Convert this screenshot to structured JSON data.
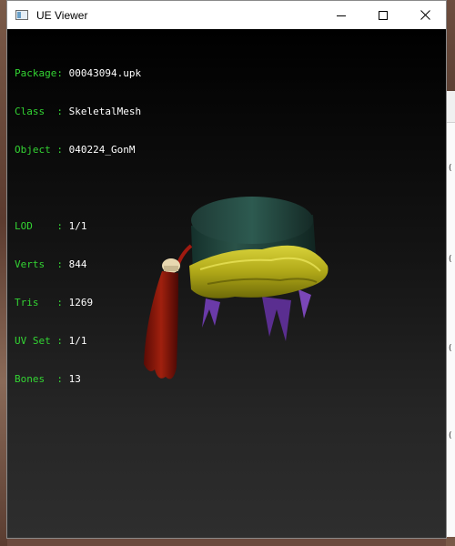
{
  "window": {
    "title": "UE Viewer",
    "icon": "app-window-icon",
    "controls": [
      "minimize-icon",
      "maximize-icon",
      "close-icon"
    ]
  },
  "info": {
    "package_label": "Package:",
    "package": "00043094.upk",
    "class_label": "Class  :",
    "class": "SkeletalMesh",
    "object_label": "Object :",
    "object": "040224_GonM",
    "lod_label": "LOD    :",
    "lod": "1/1",
    "verts_label": "Verts  :",
    "verts": "844",
    "tris_label": "Tris   :",
    "tris": "1269",
    "uvset_label": "UV Set :",
    "uvset": "1/1",
    "bones_label": "Bones  :",
    "bones": "13"
  },
  "colors": {
    "label": "#33d433",
    "value": "#ffffff",
    "viewport_top": "#000000",
    "viewport_bottom": "#2e2e2e"
  }
}
